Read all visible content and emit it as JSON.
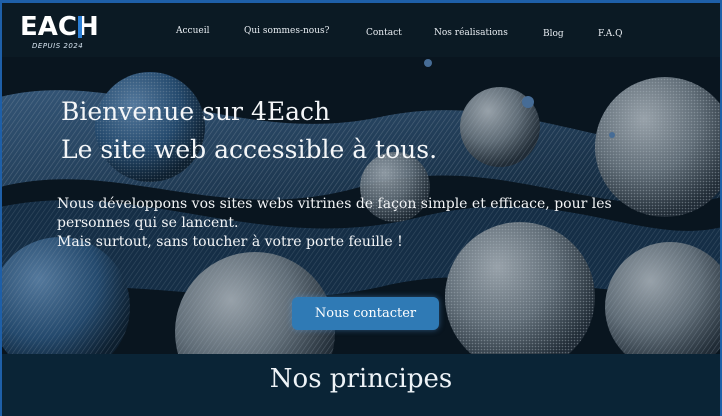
{
  "logo": {
    "text": "EACH",
    "subtitle": "DEPUIS 2024"
  },
  "nav": {
    "items": [
      "Accueil",
      "Qui sommes-nous?",
      "Contact",
      "Nos réalisations",
      "Blog",
      "F.A.Q"
    ]
  },
  "hero": {
    "title_line1": "Bienvenue sur 4Each",
    "title_line2": "Le site web accessible à tous.",
    "text_line1": "Nous développons vos sites webs vitrines de façon simple et efficace, pour les personnes qui se lancent.",
    "text_line2": "Mais surtout, sans toucher à votre porte feuille !",
    "cta_label": "Nous contacter"
  },
  "principles": {
    "title": "Nos principes"
  },
  "colors": {
    "accent": "#2f7ab5",
    "header_bg": "#0b1a24",
    "section_bg": "#0a2436",
    "frame": "#1e5fa8"
  }
}
